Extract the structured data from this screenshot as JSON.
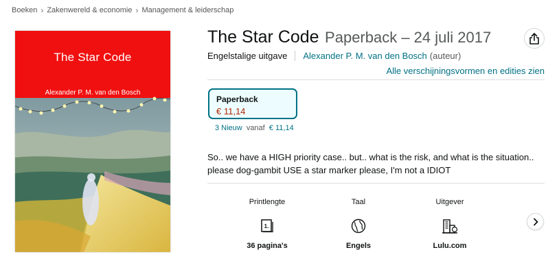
{
  "breadcrumb": [
    "Boeken",
    "Zakenwereld & economie",
    "Management & leiderschap"
  ],
  "breadcrumb_separator": "›",
  "cover": {
    "title": "The Star Code",
    "author": "Alexander P. M. van den Bosch",
    "background_color": "#f01010"
  },
  "product": {
    "title": "The Star Code",
    "format_date": "Paperback – 24 juli 2017",
    "language_edition": "Engelstalige uitgave",
    "author": "Alexander P. M. van den Bosch",
    "author_role": "(auteur)",
    "editions_link": "Alle verschijningsvormen en edities zien",
    "share_icon": "share-icon"
  },
  "format_option": {
    "label": "Paperback",
    "price": "€ 11,14",
    "accent_color": "#007185"
  },
  "offers": {
    "count_label": "3 Nieuw",
    "from_label": "vanaf",
    "price": "€ 11,14"
  },
  "description": "So.. we have a HIGH priority case.. but.. what is the risk, and what is the situation.. please dog-gambit USE a star marker please, I'm not a IDIOT",
  "details": [
    {
      "label": "Printlengte",
      "value": "36 pagina's",
      "icon": "book-pages-icon"
    },
    {
      "label": "Taal",
      "value": "Engels",
      "icon": "globe-icon"
    },
    {
      "label": "Uitgever",
      "value": "Lulu.com",
      "icon": "building-icon"
    }
  ],
  "carousel_next_icon": "chevron-right-icon",
  "colors": {
    "link": "#007185",
    "price": "#b12704",
    "text": "#0f1111",
    "muted": "#565959"
  }
}
